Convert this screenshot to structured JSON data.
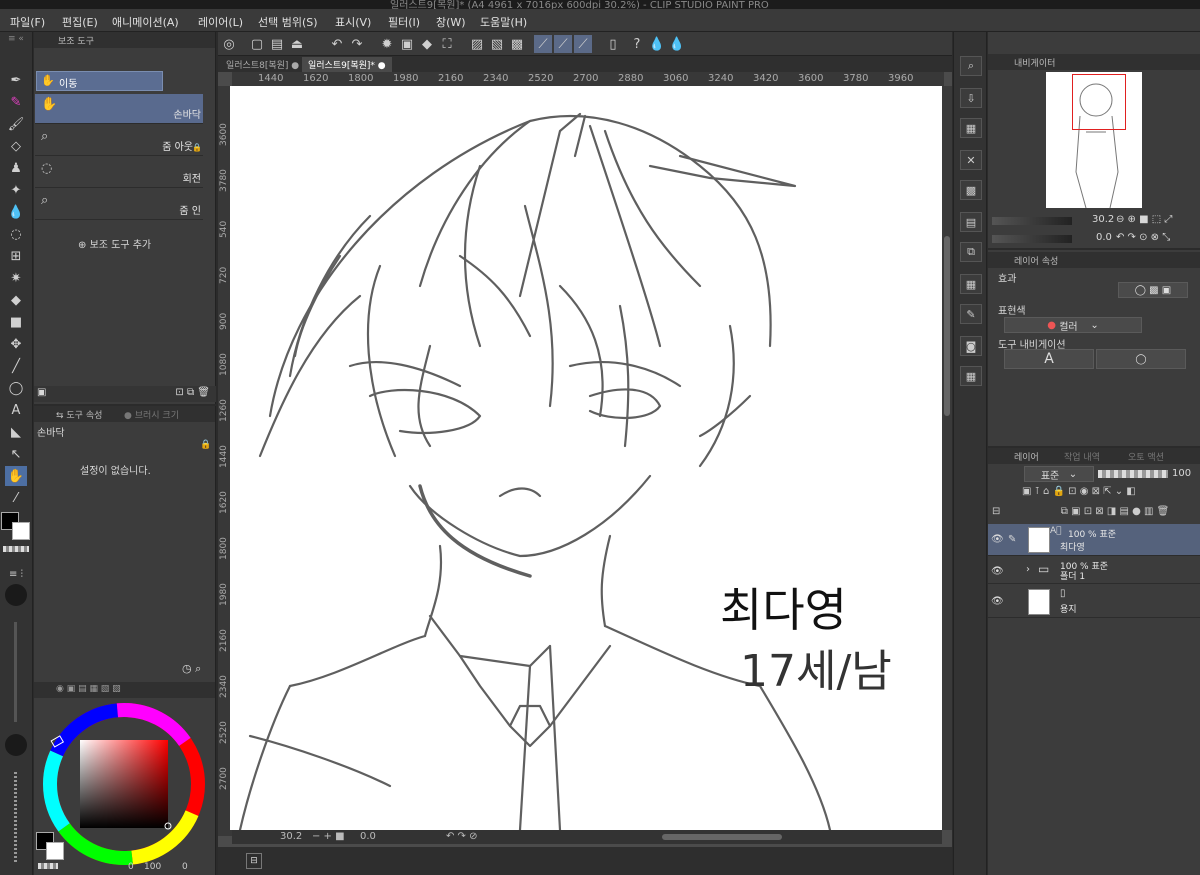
{
  "window": {
    "title": "일러스트9[복원]* (A4 4961 x 7016px 600dpi 30.2%)  - CLIP STUDIO PAINT PRO"
  },
  "menu": [
    "파일(F)",
    "편집(E)",
    "애니메이션(A)",
    "레이어(L)",
    "선택 범위(S)",
    "표시(V)",
    "필터(I)",
    "창(W)",
    "도움말(H)"
  ],
  "tabs": [
    {
      "label": "일러스트8[복원]"
    },
    {
      "label": "일러스트9[복원]*"
    }
  ],
  "ruler_top": [
    "1440",
    "1620",
    "1800",
    "1980",
    "2160",
    "2340",
    "2520",
    "2700",
    "2880",
    "3060",
    "3240",
    "3420",
    "3600",
    "3780",
    "3960"
  ],
  "ruler_left": [
    "3600",
    "3780",
    "540",
    "720",
    "900",
    "1080",
    "1260",
    "1440",
    "1620",
    "1800",
    "1980",
    "2160",
    "2340",
    "2520",
    "2700"
  ],
  "sub_tool": {
    "header": "보조 도구",
    "group_label": "이동",
    "items": [
      {
        "label": "손바닥",
        "icon": "hand-icon"
      },
      {
        "label": "줌 아웃",
        "icon": "magnifier-icon"
      },
      {
        "label": "회전",
        "icon": "rotate-icon"
      },
      {
        "label": "줌 인",
        "icon": "magnifier-icon"
      }
    ],
    "add_label": "보조 도구 추가"
  },
  "tool_property": {
    "tab1": "도구 속성",
    "tab2": "브러시 크기",
    "tool_name": "손바닥",
    "empty_message": "설정이 없습니다."
  },
  "color": {
    "main": "#000000",
    "sub": "#ffffff",
    "hue": "#ff0000",
    "footer_left": "0",
    "footer_mid": "100",
    "footer_right": "0"
  },
  "canvas": {
    "zoom": "30.2",
    "rotation": "0.0",
    "text_name": "최다영",
    "text_info": "17세/남"
  },
  "navigator": {
    "header": "내비게이터",
    "zoom": "30.2",
    "rotation": "0.0"
  },
  "layer_property": {
    "header": "레이어 속성",
    "effect_label": "효과",
    "expression_label": "표현색",
    "expression_value": "컬러",
    "tool_nav_label": "도구 내비게이션"
  },
  "layers_panel": {
    "tab1": "레이어",
    "tab2": "작업 내역",
    "tab3": "오토 액션",
    "blend_mode": "표준",
    "opacity": "100",
    "layers": [
      {
        "line1": "100 % 표준",
        "line2": "최다영",
        "selected": true,
        "type": "vector"
      },
      {
        "line1": "100 % 표준",
        "line2": "폴더 1",
        "selected": false,
        "type": "folder"
      },
      {
        "line1": "",
        "line2": "용지",
        "selected": false,
        "type": "paper"
      }
    ]
  }
}
